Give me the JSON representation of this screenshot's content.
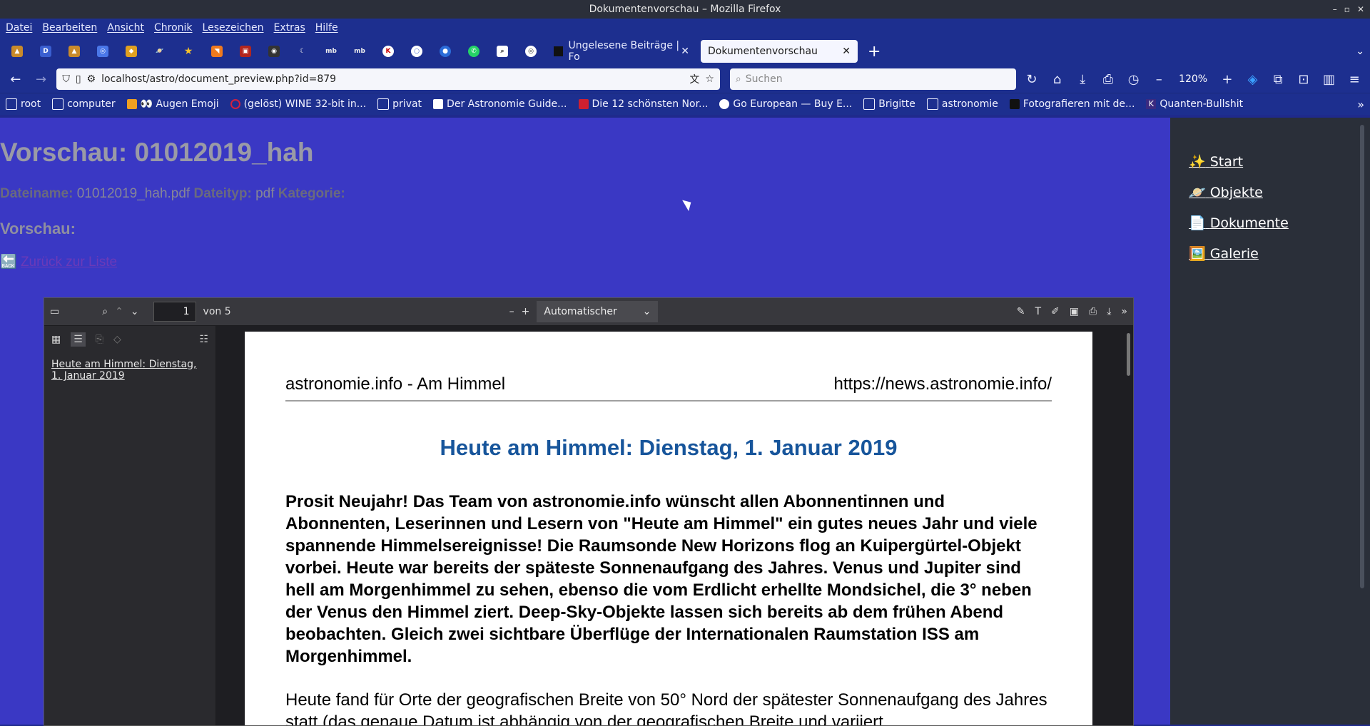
{
  "window": {
    "title": "Dokumentenvorschau – Mozilla Firefox"
  },
  "menubar": [
    "Datei",
    "Bearbeiten",
    "Ansicht",
    "Chronik",
    "Lesezeichen",
    "Extras",
    "Hilfe"
  ],
  "tabs": [
    {
      "label": "Ungelesene Beiträge | Fo"
    },
    {
      "label": "Dokumentenvorschau"
    }
  ],
  "nav": {
    "url": "localhost/astro/document_preview.php?id=879",
    "search_placeholder": "Suchen",
    "zoom": "120%"
  },
  "bookmarks": [
    "root",
    "computer",
    "👀 Augen Emoji",
    "(gelöst) WINE 32-bit in...",
    "privat",
    "Der Astronomie Guide...",
    "Die 12 schönsten Nor...",
    "Go European — Buy E...",
    "Brigitte",
    "astronomie",
    "Fotografieren mit de...",
    "Quanten-Bullshit"
  ],
  "page": {
    "title": "Vorschau: 01012019_hah",
    "filename_label": "Dateiname:",
    "filename": "01012019_hah.pdf",
    "filetype_label": "Dateityp:",
    "filetype": "pdf",
    "category_label": "Kategorie:",
    "preview_heading": "Vorschau:",
    "back_icon": "🔙",
    "back_link": "Zurück zur Liste"
  },
  "sidebar_links": [
    {
      "icon": "✨",
      "label": "Start"
    },
    {
      "icon": "🪐",
      "label": "Objekte"
    },
    {
      "icon": "📄",
      "label": "Dokumente"
    },
    {
      "icon": "🖼️",
      "label": "Galerie"
    }
  ],
  "viewer": {
    "page_number": "1",
    "page_count": "von 5",
    "zoom": "Automatischer Zoom",
    "outline_item": "Heute am Himmel: Dienstag, 1. Januar 2019"
  },
  "pdf": {
    "header_left": "astronomie.info - Am Himmel",
    "header_right": "https://news.astronomie.info/",
    "title": "Heute am Himmel: Dienstag, 1. Januar 2019",
    "lead": "Prosit Neujahr! Das Team von astronomie.info wünscht allen Abonnentinnen und Abonnenten, Leserinnen und Lesern von \"Heute am Himmel\" ein gutes neues Jahr und viele spannende Himmelsereignisse! Die Raumsonde New Horizons flog an Kuipergürtel-Objekt vorbei. Heute war bereits der späteste Sonnenaufgang des Jahres. Venus und Jupiter sind hell am Morgenhimmel zu sehen, ebenso die vom Erdlicht erhellte Mondsichel, die 3° neben der Venus den Himmel ziert. Deep-Sky-Objekte lassen sich bereits ab dem frühen Abend beobachten. Gleich zwei sichtbare Überflüge der Internationalen Raumstation ISS am Morgenhimmel.",
    "body": "Heute fand für Orte der geografischen Breite von 50° Nord der spätester Sonnenaufgang des Jahres statt (das genaue Datum ist abhängig von der geografischen Breite und variiert"
  }
}
